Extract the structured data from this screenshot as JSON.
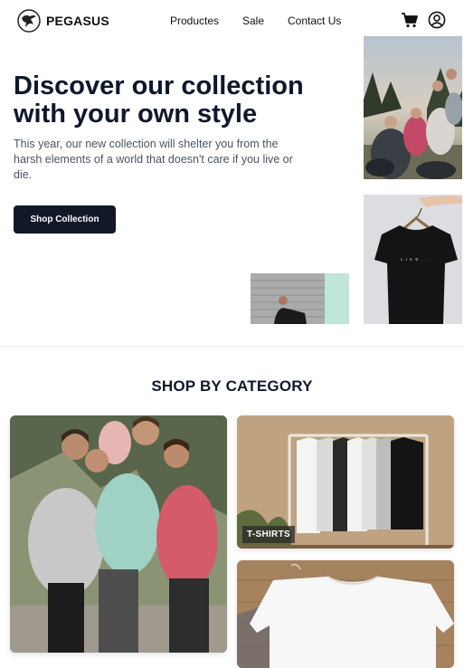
{
  "brand": {
    "name": "PEGASUS"
  },
  "nav": {
    "links": [
      "Productes",
      "Sale",
      "Contact Us"
    ],
    "icons": [
      "cart-icon",
      "user-icon"
    ]
  },
  "hero": {
    "title": "Discover our collection with your own style",
    "description": "This year, our new collection will shelter you from the harsh elements of a world that doesn't care if you live or die.",
    "button_label": "Shop Collection"
  },
  "categories": {
    "title": "SHOP BY CATEGORY",
    "items": [
      {
        "label": ""
      },
      {
        "label": "T-SHIRTS"
      },
      {
        "label": ""
      }
    ]
  },
  "colors": {
    "primary": "#111827",
    "text_muted": "#4b5563",
    "background": "#ffffff"
  }
}
